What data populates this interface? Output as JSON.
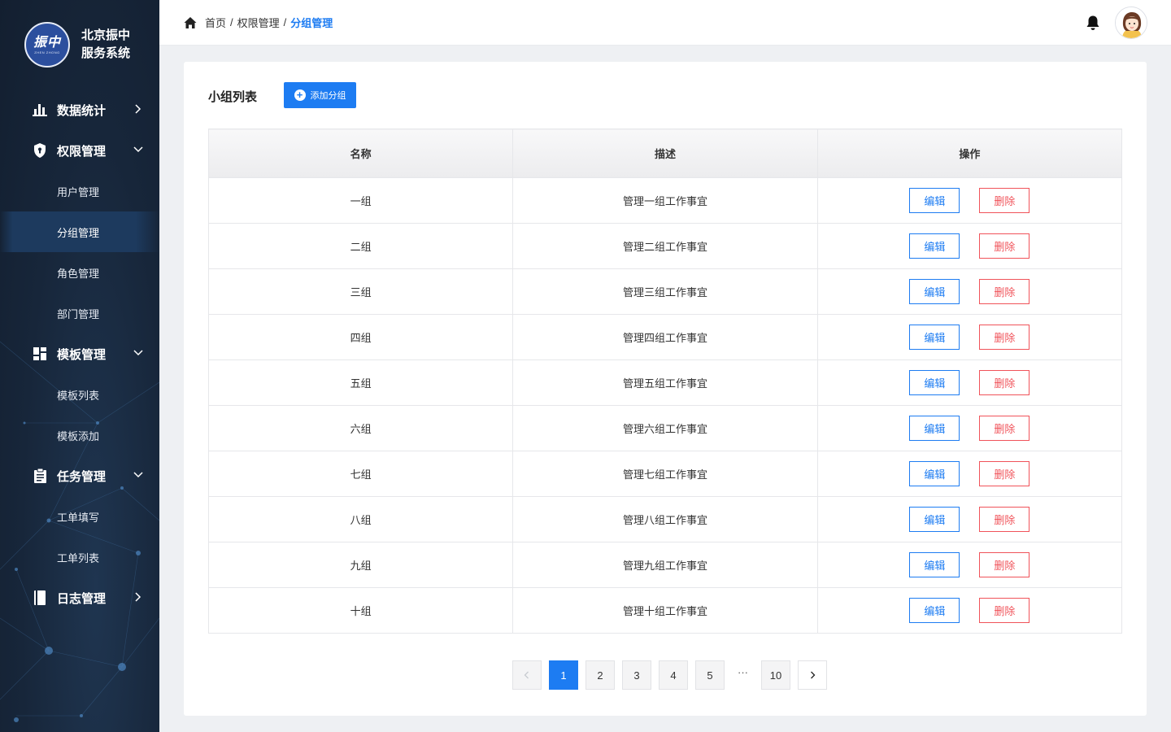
{
  "brand": {
    "logo_text": "振中",
    "logo_sub": "ZHEN ZHONG",
    "name_line1": "北京振中",
    "name_line2": "服务系统"
  },
  "sidebar": {
    "groups": [
      {
        "label": "数据统计",
        "icon": "bar-chart-icon",
        "expanded": false,
        "items": []
      },
      {
        "label": "权限管理",
        "icon": "shield-icon",
        "expanded": true,
        "items": [
          "用户管理",
          "分组管理",
          "角色管理",
          "部门管理"
        ]
      },
      {
        "label": "模板管理",
        "icon": "grid-icon",
        "expanded": true,
        "items": [
          "模板列表",
          "模板添加"
        ]
      },
      {
        "label": "任务管理",
        "icon": "clipboard-icon",
        "expanded": true,
        "items": [
          "工单填写",
          "工单列表"
        ]
      },
      {
        "label": "日志管理",
        "icon": "book-icon",
        "expanded": false,
        "items": []
      }
    ],
    "active_item": "分组管理"
  },
  "header": {
    "breadcrumb": [
      "首页",
      "权限管理",
      "分组管理"
    ],
    "separator": "/"
  },
  "main": {
    "title": "小组列表",
    "add_button": "添加分组",
    "columns": [
      "名称",
      "描述",
      "操作"
    ],
    "rows": [
      {
        "name": "一组",
        "desc": "管理一组工作事宜"
      },
      {
        "name": "二组",
        "desc": "管理二组工作事宜"
      },
      {
        "name": "三组",
        "desc": "管理三组工作事宜"
      },
      {
        "name": "四组",
        "desc": "管理四组工作事宜"
      },
      {
        "name": "五组",
        "desc": "管理五组工作事宜"
      },
      {
        "name": "六组",
        "desc": "管理六组工作事宜"
      },
      {
        "name": "七组",
        "desc": "管理七组工作事宜"
      },
      {
        "name": "八组",
        "desc": "管理八组工作事宜"
      },
      {
        "name": "九组",
        "desc": "管理九组工作事宜"
      },
      {
        "name": "十组",
        "desc": "管理十组工作事宜"
      }
    ],
    "edit_label": "编辑",
    "delete_label": "删除"
  },
  "pagination": {
    "pages": [
      "1",
      "2",
      "3",
      "4",
      "5"
    ],
    "ellipsis": "···",
    "last": "10",
    "current": "1",
    "prev_icon": "chevron-left-icon",
    "next_icon": "chevron-right-icon"
  },
  "colors": {
    "primary": "#1d7cf2",
    "danger": "#f0535a",
    "sidebar_bg": "#17263a"
  }
}
